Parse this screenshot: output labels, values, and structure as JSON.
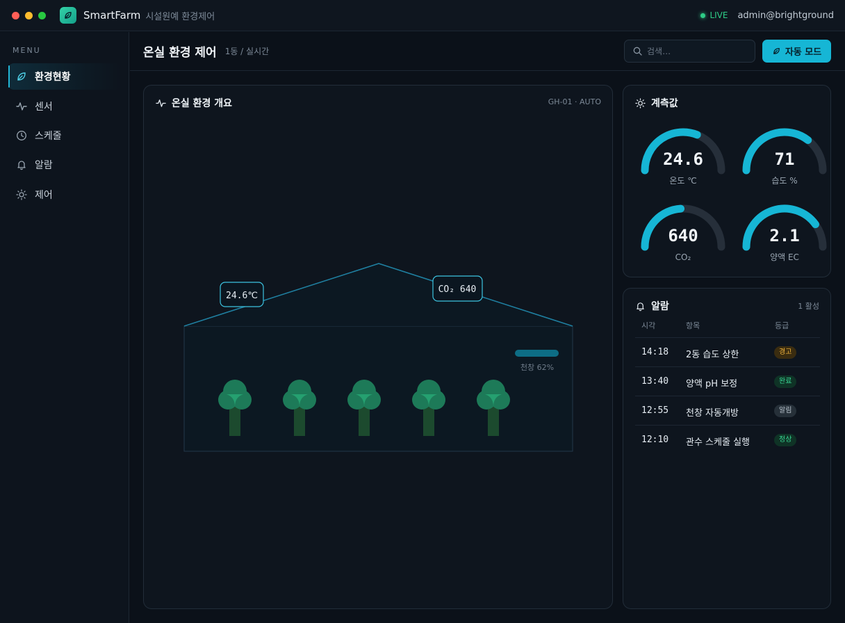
{
  "window": {
    "app_name": "SmartFarm",
    "app_subtitle": "시설원예 환경제어",
    "live_label": "LIVE",
    "user": "admin@brightground"
  },
  "sidebar": {
    "heading": "MENU",
    "items": [
      {
        "label": "환경현황",
        "icon": "leaf-icon",
        "active": true
      },
      {
        "label": "센서",
        "icon": "pulse-icon"
      },
      {
        "label": "스케줄",
        "icon": "clock-icon"
      },
      {
        "label": "알람",
        "icon": "bell-icon"
      },
      {
        "label": "제어",
        "icon": "sun-icon"
      }
    ]
  },
  "header": {
    "title": "온실 환경 제어",
    "subtitle": "1동 / 실시간",
    "search_placeholder": "검색…",
    "auto_button": "자동 모드"
  },
  "overview": {
    "title": "온실 환경 개요",
    "meta": "GH-01 · AUTO",
    "temp_tag": "24.6℃",
    "co2_tag": "CO₂ 640",
    "vent_label": "천창 62%",
    "vent_percent": 62,
    "plant_count": 5
  },
  "gauges": {
    "title": "계측값",
    "items": [
      {
        "value": "24.6",
        "label": "온도 ℃",
        "fill": 0.62
      },
      {
        "value": "71",
        "label": "습도 %",
        "fill": 0.71
      },
      {
        "value": "640",
        "label": "CO₂",
        "fill": 0.48
      },
      {
        "value": "2.1",
        "label": "양액 EC",
        "fill": 0.8
      }
    ]
  },
  "alarms": {
    "title": "알람",
    "count": "1 활성",
    "columns": [
      "시각",
      "항목",
      "등급"
    ],
    "rows": [
      {
        "time": "14:18",
        "item": "2동 습도 상한",
        "level": "경고",
        "type": "warn"
      },
      {
        "time": "13:40",
        "item": "양액 pH 보정",
        "level": "완료",
        "type": "done"
      },
      {
        "time": "12:55",
        "item": "천창 자동개방",
        "level": "알림",
        "type": "info"
      },
      {
        "time": "12:10",
        "item": "관수 스케줄 실행",
        "level": "정상",
        "type": "ok"
      }
    ]
  },
  "colors": {
    "accent": "#16b6d5",
    "background": "#0b1119",
    "live": "#2ecc87",
    "plant": "#1f8a5c"
  }
}
